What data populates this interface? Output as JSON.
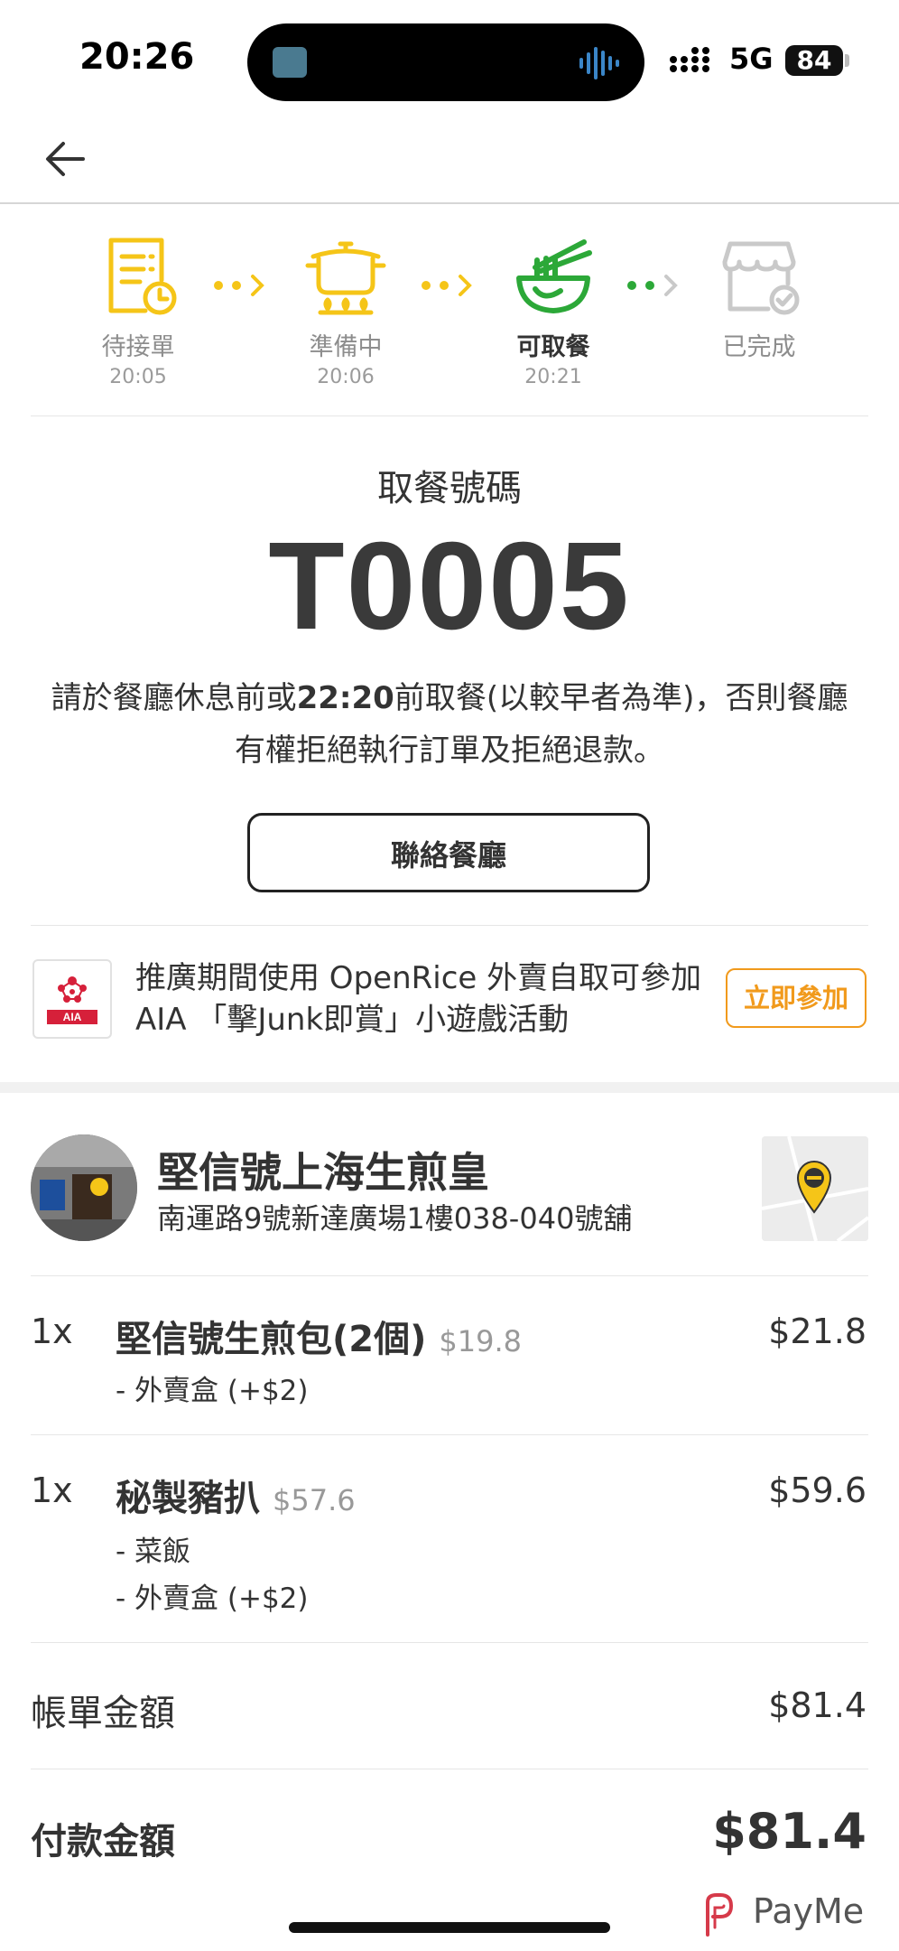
{
  "status_bar": {
    "time": "20:26",
    "network": "5G",
    "battery": "84"
  },
  "steps": [
    {
      "label": "待接單",
      "time": "20:05"
    },
    {
      "label": "準備中",
      "time": "20:06"
    },
    {
      "label": "可取餐",
      "time": "20:21"
    },
    {
      "label": "已完成",
      "time": ""
    }
  ],
  "colors": {
    "accent_yellow": "#f5c518",
    "accent_green": "#2ca838",
    "inactive_gray": "#c9c9c9",
    "promo_orange": "#f19a1c"
  },
  "pickup": {
    "label": "取餐號碼",
    "number": "T0005",
    "notice_pre": "請於餐廳休息前或",
    "notice_time": "22:20",
    "notice_post": "前取餐(以較早者為準)，否則餐廳有權拒絕執行訂單及拒絕退款。",
    "contact_button": "聯絡餐廳"
  },
  "promo": {
    "text": "推廣期間使用 OpenRice 外賣自取可參加 AIA 「擊Junk即賞」小遊戲活動",
    "button": "立即參加",
    "logo_text": "AIA"
  },
  "restaurant": {
    "name": "堅信號上海生煎皇",
    "address": "南運路9號新達廣場1樓038-040號舖"
  },
  "items": [
    {
      "qty": "1x",
      "name": "堅信號生煎包(2個)",
      "unit_price": "$19.8",
      "price": "$21.8",
      "modifiers": [
        "- 外賣盒 (+$2)"
      ]
    },
    {
      "qty": "1x",
      "name": "秘製豬扒",
      "unit_price": "$57.6",
      "price": "$59.6",
      "modifiers": [
        "- 菜飯",
        "- 外賣盒 (+$2)"
      ]
    }
  ],
  "summary": {
    "bill_label": "帳單金額",
    "bill_value": "$81.4",
    "pay_label": "付款金額",
    "pay_value": "$81.4",
    "payment_method": "PayMe"
  }
}
